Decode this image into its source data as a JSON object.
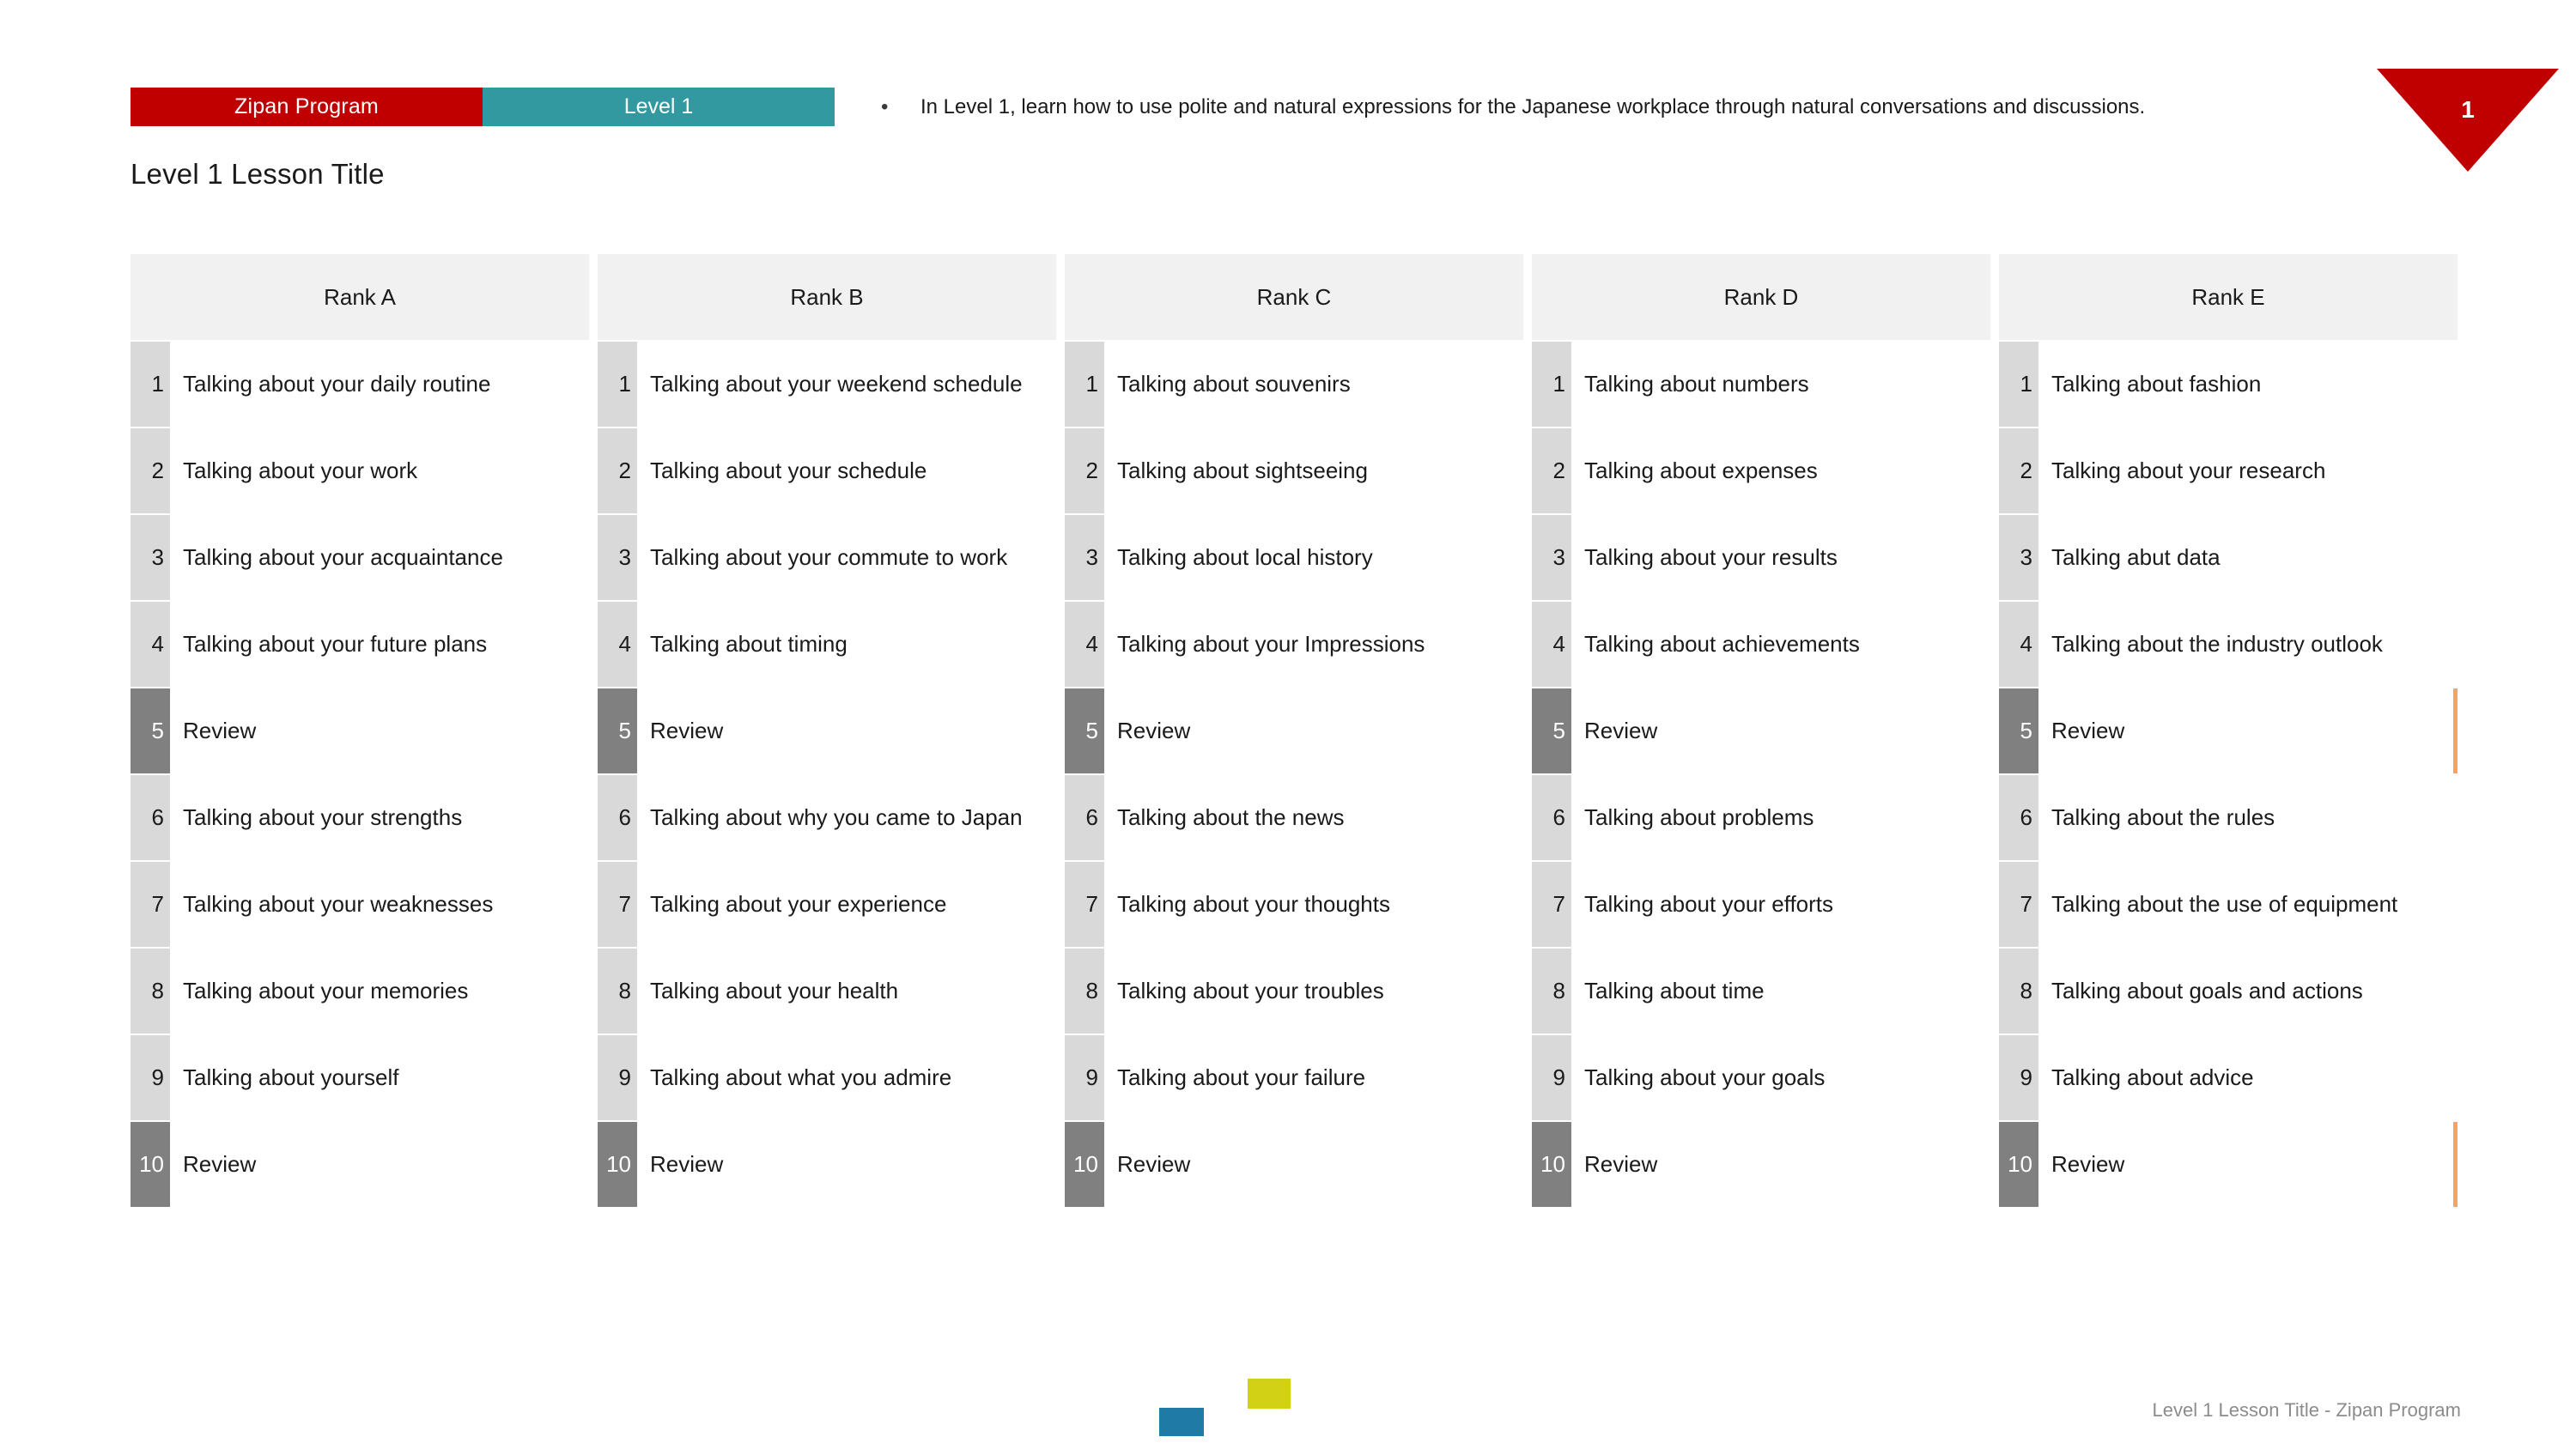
{
  "banner": {
    "program_label": "Zipan Program",
    "level_label": "Level 1",
    "program_color": "#c00000",
    "level_color": "#3399a0"
  },
  "intro": {
    "bullet_glyph": "•",
    "text": "In Level 1, learn how to use polite and natural expressions for the Japanese workplace through natural conversations and discussions."
  },
  "page_badge": {
    "number": "1",
    "color": "#c00000"
  },
  "slide_title": "Level 1 Lesson Title",
  "footer": {
    "text": "Level 1 Lesson Title - Zipan Program",
    "square_blue_color": "#1f7ba6",
    "square_yellow_color": "#d3d116"
  },
  "table": {
    "review_label": "Review",
    "review_accent_color": "#f7a35c",
    "columns": [
      {
        "header": "Rank A",
        "rows": [
          {
            "num": "1",
            "text": "Talking about your daily routine",
            "review": false
          },
          {
            "num": "2",
            "text": "Talking about your work",
            "review": false
          },
          {
            "num": "3",
            "text": "Talking about your acquaintance",
            "review": false
          },
          {
            "num": "4",
            "text": "Talking about your future plans",
            "review": false
          },
          {
            "num": "5",
            "text": "Review",
            "review": true
          },
          {
            "num": "6",
            "text": "Talking about your strengths",
            "review": false
          },
          {
            "num": "7",
            "text": "Talking about your weaknesses",
            "review": false
          },
          {
            "num": "8",
            "text": "Talking about your memories",
            "review": false
          },
          {
            "num": "9",
            "text": "Talking about yourself",
            "review": false
          },
          {
            "num": "10",
            "text": "Review",
            "review": true
          }
        ]
      },
      {
        "header": "Rank B",
        "rows": [
          {
            "num": "1",
            "text": "Talking about your weekend schedule",
            "review": false
          },
          {
            "num": "2",
            "text": "Talking about your schedule",
            "review": false
          },
          {
            "num": "3",
            "text": "Talking about your commute to work",
            "review": false
          },
          {
            "num": "4",
            "text": "Talking about timing",
            "review": false
          },
          {
            "num": "5",
            "text": "Review",
            "review": true
          },
          {
            "num": "6",
            "text": "Talking about why you came to Japan",
            "review": false
          },
          {
            "num": "7",
            "text": "Talking about your experience",
            "review": false
          },
          {
            "num": "8",
            "text": "Talking about your health",
            "review": false
          },
          {
            "num": "9",
            "text": "Talking about what you admire",
            "review": false
          },
          {
            "num": "10",
            "text": "Review",
            "review": true
          }
        ]
      },
      {
        "header": "Rank C",
        "rows": [
          {
            "num": "1",
            "text": "Talking about souvenirs",
            "review": false
          },
          {
            "num": "2",
            "text": "Talking about sightseeing",
            "review": false
          },
          {
            "num": "3",
            "text": "Talking about local history",
            "review": false
          },
          {
            "num": "4",
            "text": "Talking about your Impressions",
            "review": false
          },
          {
            "num": "5",
            "text": "Review",
            "review": true
          },
          {
            "num": "6",
            "text": "Talking about the news",
            "review": false
          },
          {
            "num": "7",
            "text": "Talking about your thoughts",
            "review": false
          },
          {
            "num": "8",
            "text": "Talking about your troubles",
            "review": false
          },
          {
            "num": "9",
            "text": "Talking about your failure",
            "review": false
          },
          {
            "num": "10",
            "text": "Review",
            "review": true
          }
        ]
      },
      {
        "header": "Rank D",
        "rows": [
          {
            "num": "1",
            "text": "Talking about numbers",
            "review": false
          },
          {
            "num": "2",
            "text": "Talking about expenses",
            "review": false
          },
          {
            "num": "3",
            "text": "Talking about your results",
            "review": false
          },
          {
            "num": "4",
            "text": "Talking about achievements",
            "review": false
          },
          {
            "num": "5",
            "text": "Review",
            "review": true
          },
          {
            "num": "6",
            "text": "Talking about problems",
            "review": false
          },
          {
            "num": "7",
            "text": "Talking about your efforts",
            "review": false
          },
          {
            "num": "8",
            "text": "Talking about time",
            "review": false
          },
          {
            "num": "9",
            "text": "Talking about your goals",
            "review": false
          },
          {
            "num": "10",
            "text": "Review",
            "review": true
          }
        ]
      },
      {
        "header": "Rank E",
        "rows": [
          {
            "num": "1",
            "text": "Talking about fashion",
            "review": false
          },
          {
            "num": "2",
            "text": "Talking about your research",
            "review": false
          },
          {
            "num": "3",
            "text": "Talking abut data",
            "review": false
          },
          {
            "num": "4",
            "text": "Talking about the industry outlook",
            "review": false
          },
          {
            "num": "5",
            "text": "Review",
            "review": true
          },
          {
            "num": "6",
            "text": "Talking about the rules",
            "review": false
          },
          {
            "num": "7",
            "text": "Talking about the use of equipment",
            "review": false
          },
          {
            "num": "8",
            "text": "Talking about goals and actions",
            "review": false
          },
          {
            "num": "9",
            "text": "Talking about advice",
            "review": false
          },
          {
            "num": "10",
            "text": "Review",
            "review": true
          }
        ]
      }
    ]
  }
}
